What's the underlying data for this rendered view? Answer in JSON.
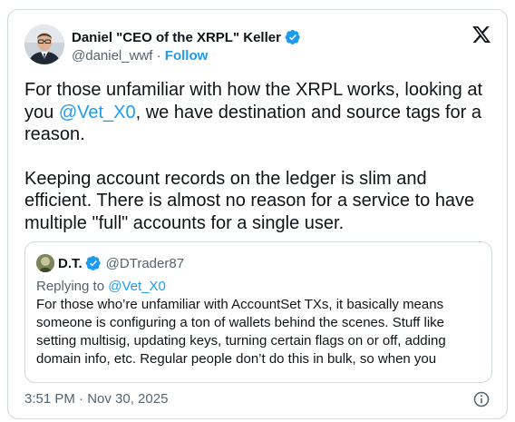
{
  "author": {
    "display_name": "Daniel \"CEO of the XRPL\" Keller",
    "handle": "@daniel_wwf",
    "separator": "·",
    "follow_label": "Follow"
  },
  "tweet": {
    "para1_before": "For those unfamiliar with how the XRPL works, looking at you ",
    "para1_mention": "@Vet_X0",
    "para1_after": ", we have destination and source tags for a reason.",
    "para2": "Keeping account records on the ledger is slim and efficient. There is almost no reason for a service to have multiple \"full\" accounts for a single user."
  },
  "quoted": {
    "display_name": "D.T.",
    "handle": "@DTrader87",
    "replying_prefix": "Replying to ",
    "replying_handle": "@Vet_X0",
    "text": "For those who’re unfamiliar with AccountSet TXs, it basically means someone is configuring a ton of wallets behind the scenes. Stuff like setting multisig, updating keys, turning certain flags on or off, adding domain info, etc. Regular people don’t do this in bulk, so when you"
  },
  "footer": {
    "timestamp": "3:51 PM · Nov 30, 2025"
  },
  "icons": {
    "verified": "verified-badge-icon",
    "x_logo": "x-logo-icon",
    "info": "info-icon"
  },
  "colors": {
    "accent": "#1d9bf0",
    "text": "#0f1419",
    "muted": "#536471",
    "border": "#cfd9de"
  }
}
